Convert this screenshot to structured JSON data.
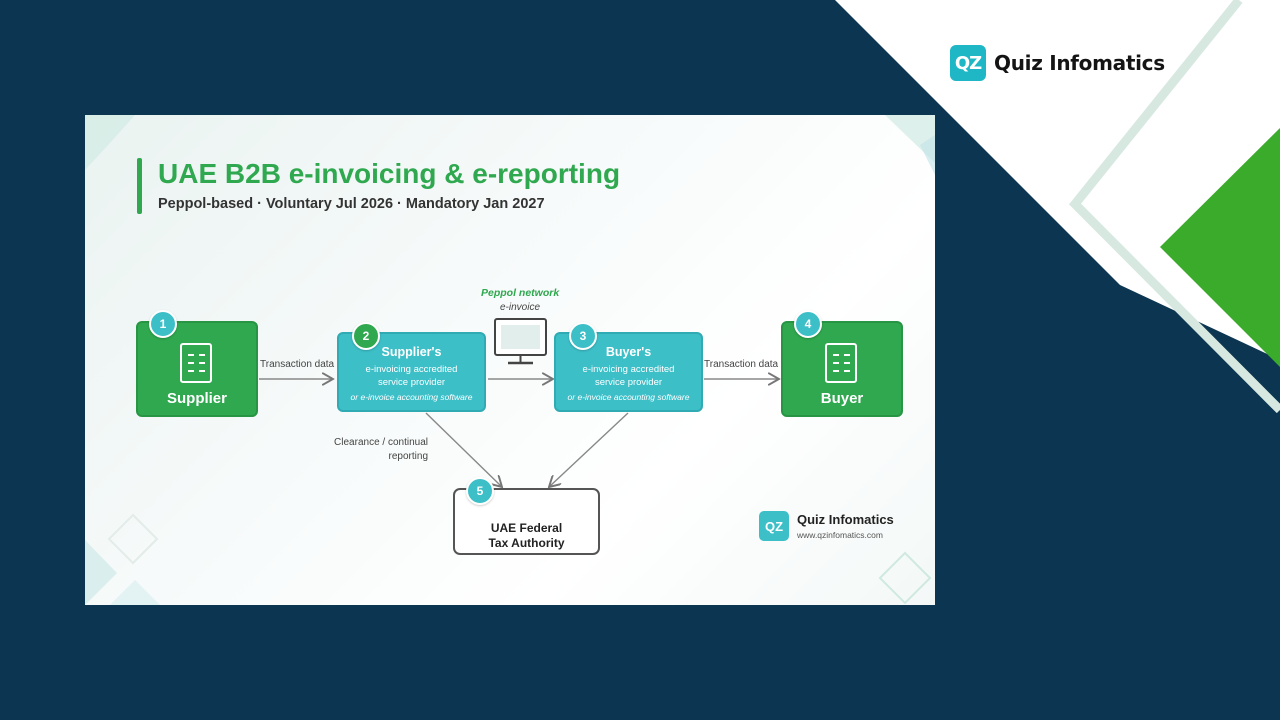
{
  "brand": {
    "logo_text": "QZ",
    "name": "Quiz Infomatics"
  },
  "slide": {
    "title": "UAE B2B e-invoicing & e-reporting",
    "subtitle": "Peppol-based · Voluntary Jul 2026 · Mandatory Jan 2027",
    "nodes": [
      {
        "number": "1",
        "name": "Supplier"
      },
      {
        "number": "2",
        "name": "Supplier's",
        "line1": "e-invoicing accredited",
        "line2": "service provider",
        "line3": "or e-invoice accounting software"
      },
      {
        "number": "3",
        "name": "Buyer's",
        "line1": "e-invoicing accredited",
        "line2": "service provider",
        "line3": "or e-invoice accounting software"
      },
      {
        "number": "4",
        "name": "Buyer"
      },
      {
        "number": "5",
        "name_line1": "UAE Federal",
        "name_line2": "Tax Authority"
      }
    ],
    "labels": {
      "transaction_left": "Transaction data",
      "transaction_right": "Transaction data",
      "peppol_network": "Peppol network",
      "e_invoice": "e-invoice",
      "clearance_line1": "Clearance / continual",
      "clearance_line2": "reporting"
    },
    "footer_brand": {
      "logo_text": "QZ",
      "name": "Quiz Infomatics",
      "url": "www.qzinfomatics.com"
    }
  },
  "colors": {
    "background": "#0b3550",
    "green": "#2fa84f",
    "teal": "#3dbfc8",
    "logo": "#1fb7c6"
  },
  "icons": [
    "document-icon",
    "monitor-icon",
    "bank-icon"
  ]
}
